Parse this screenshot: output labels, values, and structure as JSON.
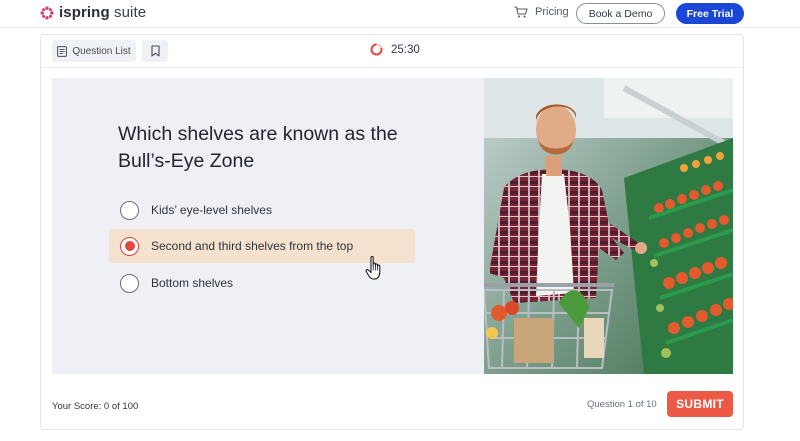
{
  "nav": {
    "logo_prefix": "ispring",
    "logo_suffix": "suite",
    "pricing_label": "Pricing",
    "book_demo_label": "Book a Demo",
    "free_trial_label": "Free Trial",
    "brand_color": "#d23c6b",
    "cta_color": "#1a47d6"
  },
  "player": {
    "question_list_label": "Question List",
    "timer": "25:30",
    "question": "Which shelves are known as the Bull’s-Eye Zone",
    "options": [
      {
        "label": "Kids’ eye-level shelves",
        "selected": false
      },
      {
        "label": "Second and third shelves from the top",
        "selected": true
      },
      {
        "label": "Bottom shelves",
        "selected": false
      }
    ],
    "score_label": "Your Score: 0 of 100",
    "question_counter": "Question 1 of 10",
    "submit_label": "SUBMIT",
    "accent_color": "#ec5a45",
    "selected_bg": "#f4e2cf"
  },
  "icons": [
    "cart-icon",
    "list-icon",
    "bookmark-icon",
    "timer-icon",
    "hand-cursor-icon"
  ]
}
